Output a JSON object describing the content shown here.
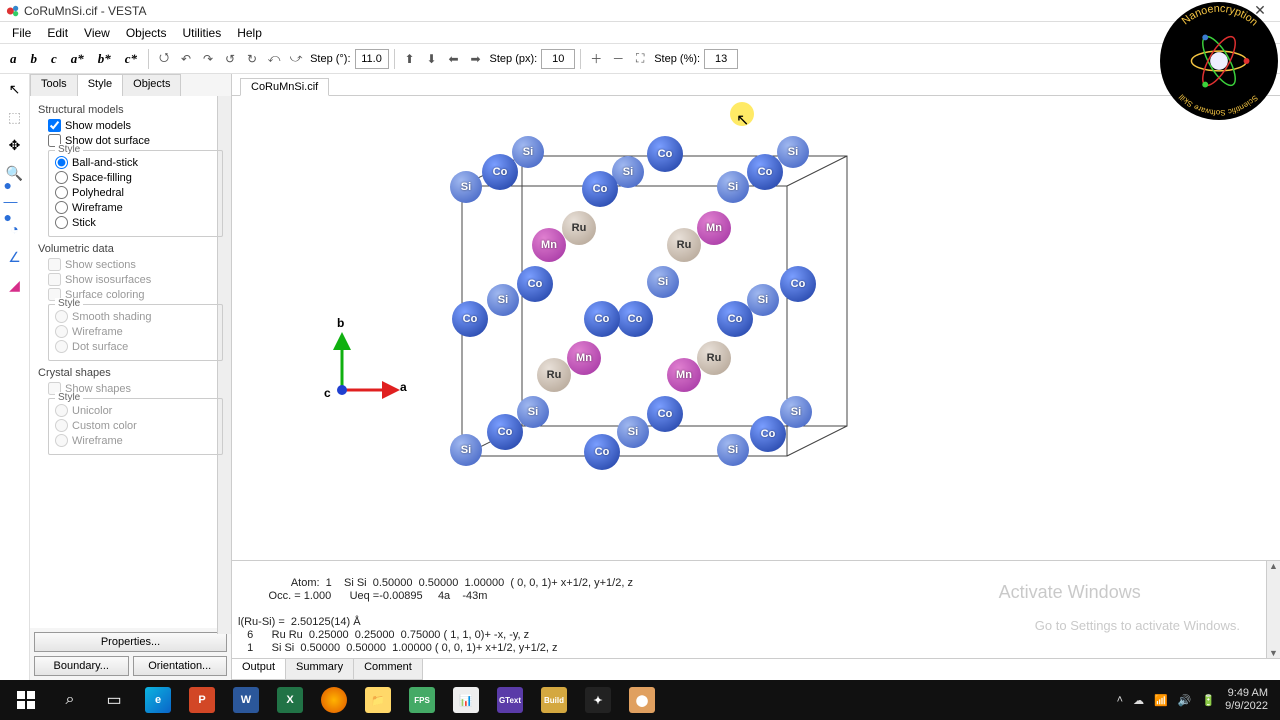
{
  "window": {
    "title": "CoRuMnSi.cif - VESTA",
    "min": "—",
    "max": "☐",
    "close": "✕"
  },
  "menu": [
    "File",
    "Edit",
    "View",
    "Objects",
    "Utilities",
    "Help"
  ],
  "toolbar": {
    "axes": [
      "a",
      "b",
      "c",
      "a*",
      "b*",
      "c*"
    ],
    "step_deg_label": "Step (°):",
    "step_deg": "11.0",
    "step_px_label": "Step (px):",
    "step_px": "10",
    "step_pct_label": "Step (%):",
    "step_pct": "13"
  },
  "side_tabs": [
    "Tools",
    "Style",
    "Objects"
  ],
  "side_active": 1,
  "style_panel": {
    "structural_title": "Structural models",
    "show_models": "Show models",
    "show_dot": "Show dot surface",
    "style_legend": "Style",
    "rstyles": [
      "Ball-and-stick",
      "Space-filling",
      "Polyhedral",
      "Wireframe",
      "Stick"
    ],
    "volumetric_title": "Volumetric data",
    "vchecks": [
      "Show sections",
      "Show isosurfaces",
      "Surface coloring"
    ],
    "vstyles": [
      "Smooth shading",
      "Wireframe",
      "Dot surface"
    ],
    "crystal_title": "Crystal shapes",
    "show_shapes": "Show shapes",
    "cstyles": [
      "Unicolor",
      "Custom color",
      "Wireframe"
    ],
    "properties": "Properties...",
    "boundary": "Boundary...",
    "orientation": "Orientation..."
  },
  "doctab": "CoRuMnSi.cif",
  "axes_labels": {
    "a": "a",
    "b": "b",
    "c": "c"
  },
  "output": {
    "text": "Atom:  1    Si Si  0.50000  0.50000  1.00000  ( 0, 0, 1)+ x+1/2, y+1/2, z\n          Occ. = 1.000      Ueq =-0.00895     4a    -43m\n\nl(Ru-Si) =  2.50125(14) Å\n   6      Ru Ru  0.25000  0.25000  0.75000 ( 1, 1, 0)+ -x, -y, z\n   1      Si Si  0.50000  0.50000  1.00000 ( 0, 0, 1)+ x+1/2, y+1/2, z",
    "tabs": [
      "Output",
      "Summary",
      "Comment"
    ]
  },
  "watermark": {
    "l1": "Activate Windows",
    "l2": "Go to Settings to activate Windows."
  },
  "logo": {
    "top": "Nanoencryption",
    "bottom": "Scientific Software Skill"
  },
  "tray": {
    "time": "9:49 AM",
    "date": "9/9/2022"
  },
  "atoms": {
    "Co": "Co",
    "Si": "Si",
    "Mn": "Mn",
    "Ru": "Ru"
  }
}
